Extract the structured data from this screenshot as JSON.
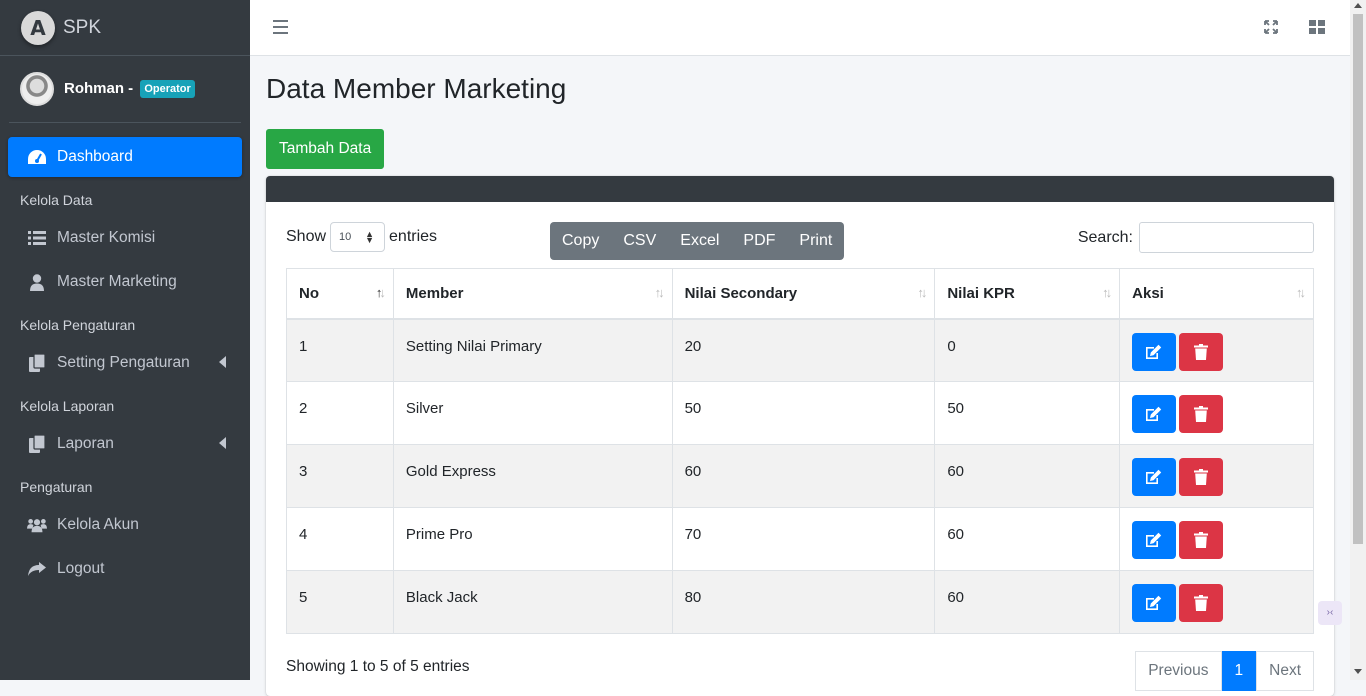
{
  "brand": {
    "name": "SPK",
    "logo_letter": "A"
  },
  "user": {
    "name": "Rohman -",
    "role": "Operator"
  },
  "sidebar": {
    "items": [
      {
        "type": "item",
        "label": "Dashboard",
        "icon": "tachometer-icon",
        "active": true
      },
      {
        "type": "header",
        "label": "Kelola Data"
      },
      {
        "type": "item",
        "label": "Master Komisi",
        "icon": "list-icon"
      },
      {
        "type": "item",
        "label": "Master Marketing",
        "icon": "user-icon"
      },
      {
        "type": "header",
        "label": "Kelola Pengaturan"
      },
      {
        "type": "item",
        "label": "Setting Pengaturan",
        "icon": "copy-icon",
        "chevron": true
      },
      {
        "type": "header",
        "label": "Kelola Laporan"
      },
      {
        "type": "item",
        "label": "Laporan",
        "icon": "copy-icon",
        "chevron": true
      },
      {
        "type": "header",
        "label": "Pengaturan"
      },
      {
        "type": "item",
        "label": "Kelola Akun",
        "icon": "users-icon"
      },
      {
        "type": "item",
        "label": "Logout",
        "icon": "share-icon"
      }
    ]
  },
  "page": {
    "title": "Data Member Marketing",
    "add_button": "Tambah Data"
  },
  "table_controls": {
    "show_label": "Show",
    "entries_value": "10",
    "entries_label": "entries",
    "export_buttons": [
      "Copy",
      "CSV",
      "Excel",
      "PDF",
      "Print"
    ],
    "search_label": "Search:"
  },
  "table": {
    "columns": [
      "No",
      "Member",
      "Nilai Secondary",
      "Nilai KPR",
      "Aksi"
    ],
    "rows": [
      [
        "1",
        "Setting Nilai Primary",
        "20",
        "0"
      ],
      [
        "2",
        "Silver",
        "50",
        "50"
      ],
      [
        "3",
        "Gold Express",
        "60",
        "60"
      ],
      [
        "4",
        "Prime Pro",
        "70",
        "60"
      ],
      [
        "5",
        "Black Jack",
        "80",
        "60"
      ]
    ]
  },
  "footer": {
    "info": "Showing 1 to 5 of 5 entries",
    "previous": "Previous",
    "current_page": "1",
    "next": "Next"
  },
  "colors": {
    "primary": "#007bff",
    "success": "#28a745",
    "danger": "#dc3545",
    "sidebar": "#343a40",
    "badge": "#17a2b8"
  }
}
